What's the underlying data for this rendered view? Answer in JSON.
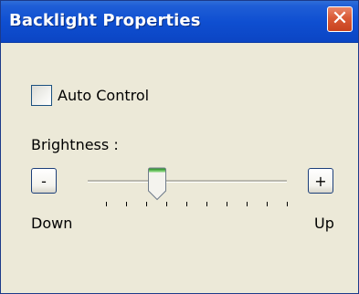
{
  "window": {
    "title": "Backlight Properties",
    "close_glyph": "✕"
  },
  "auto_control": {
    "label": "Auto Control",
    "checked": false
  },
  "brightness": {
    "label": "Brightness :",
    "decrease_label": "-",
    "increase_label": "+",
    "down_label": "Down",
    "up_label": "Up",
    "tick_count": 10,
    "level_fraction": 0.35
  },
  "colors": {
    "titlebar": "#0f4fd1",
    "close_button": "#d95a36",
    "window_background": "#ece9d8",
    "slider_thumb_accent": "#4fb84b"
  },
  "icons": {
    "close": "close-icon",
    "slider_thumb": "slider-thumb-icon"
  }
}
